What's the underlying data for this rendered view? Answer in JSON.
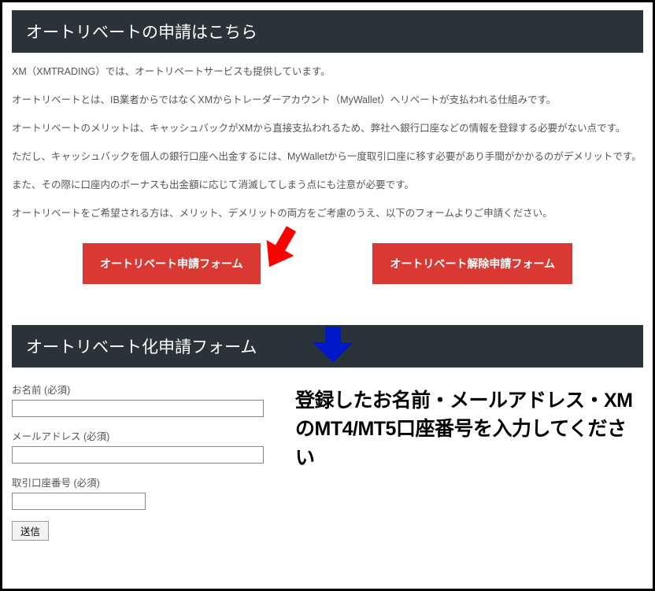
{
  "section1": {
    "title": "オートリベートの申請はこちら",
    "paragraphs": [
      "XM（XMTRADING）では、オートリベートサービスも提供しています。",
      "オートリベートとは、IB業者からではなくXMからトレーダーアカウント（MyWallet）へリベートが支払われる仕組みです。",
      "オートリベートのメリットは、キャッシュバックがXMから直接支払われるため、弊社へ銀行口座などの情報を登録する必要がない点です。",
      "ただし、キャッシュバックを個人の銀行口座へ出金するには、MyWalletから一度取引口座に移す必要があり手間がかかるのがデメリットです。",
      "また、その際に口座内のボーナスも出金額に応じて消滅してしまう点にも注意が必要です。",
      "オートリベートをご希望される方は、メリット、デメリットの両方をご考慮のうえ、以下のフォームよりご申請ください。"
    ],
    "buttons": {
      "apply": "オートリベート申請フォーム",
      "cancel": "オートリベート解除申請フォーム"
    }
  },
  "section2": {
    "title": "オートリベート化申請フォーム",
    "fields": {
      "name_label": "お名前 (必須)",
      "email_label": "メールアドレス (必須)",
      "account_label": "取引口座番号 (必須)"
    },
    "submit_label": "送信",
    "callout": "登録したお名前・メールアドレス・XMのMT4/MT5口座番号を入力してください"
  },
  "arrows": {
    "red": "red-arrow-icon",
    "blue": "blue-arrow-icon"
  },
  "colors": {
    "header_bg": "#2b333a",
    "button_bg": "#d93932",
    "arrow_red": "#ff0000",
    "arrow_blue": "#0018c7"
  }
}
